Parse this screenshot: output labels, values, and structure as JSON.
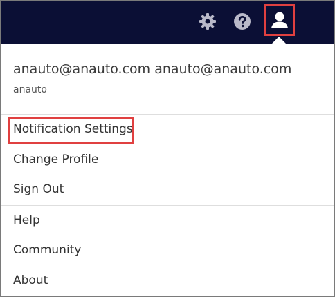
{
  "header": {
    "icons": [
      "gear-icon",
      "help-icon",
      "user-icon"
    ]
  },
  "account": {
    "email": "anauto@anauto.com anauto@anauto.com",
    "username": "anauto"
  },
  "menu": {
    "section1": [
      {
        "label": "Notification Settings"
      },
      {
        "label": "Change Profile"
      },
      {
        "label": "Sign Out"
      }
    ],
    "section2": [
      {
        "label": "Help"
      },
      {
        "label": "Community"
      },
      {
        "label": "About"
      }
    ]
  },
  "colors": {
    "topbar": "#0b0f35",
    "highlight": "#e04040",
    "icon": "#b9b9c9"
  }
}
